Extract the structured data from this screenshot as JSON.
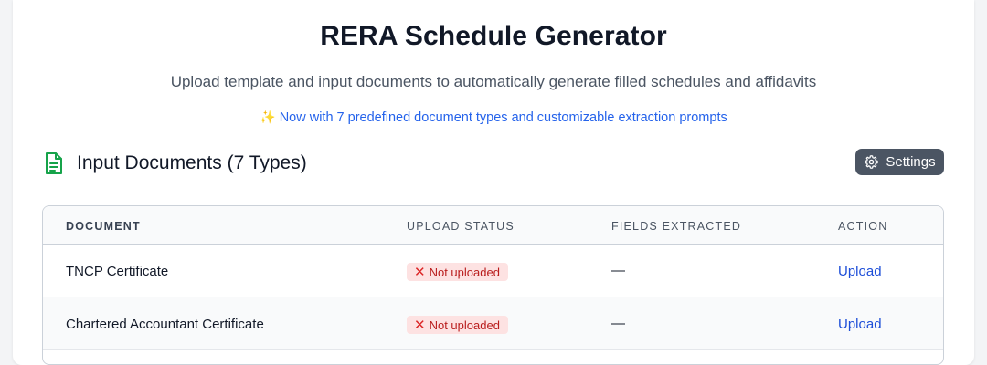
{
  "header": {
    "title": "RERA Schedule Generator",
    "subtitle": "Upload template and input documents to automatically generate filled schedules and affidavits",
    "promo_icon": "✨",
    "promo": "Now with 7 predefined document types and customizable extraction prompts"
  },
  "section": {
    "icon": "document-icon",
    "title": "Input Documents (7 Types)",
    "settings_label": "Settings"
  },
  "table": {
    "columns": [
      "DOCUMENT",
      "UPLOAD STATUS",
      "FIELDS EXTRACTED",
      "ACTION"
    ],
    "rows": [
      {
        "document": "TNCP Certificate",
        "status": "Not uploaded",
        "fields": "—",
        "action": "Upload"
      },
      {
        "document": "Chartered Accountant Certificate",
        "status": "Not uploaded",
        "fields": "—",
        "action": "Upload"
      }
    ]
  },
  "colors": {
    "accent_green": "#16a34a",
    "link_blue": "#2563eb",
    "status_red": "#b91c1c",
    "status_bg": "#fde2e2",
    "button_gray": "#4b5563"
  }
}
